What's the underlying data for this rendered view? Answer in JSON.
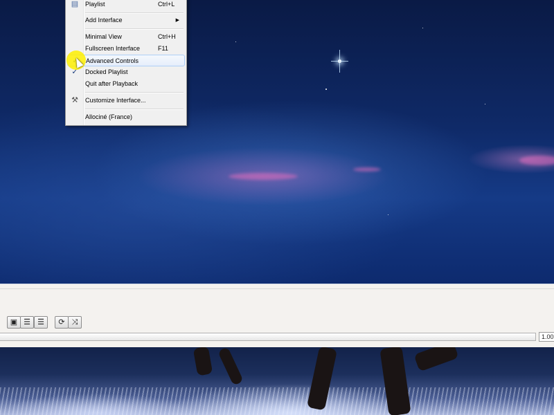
{
  "menu": {
    "items": [
      {
        "label": "Playlist",
        "shortcut": "Ctrl+L",
        "icon": "playlist-icon"
      },
      {
        "label": "Add Interface",
        "submenu": true
      },
      {
        "label": "Minimal View",
        "shortcut": "Ctrl+H"
      },
      {
        "label": "Fullscreen Interface",
        "shortcut": "F11"
      },
      {
        "label": "Advanced Controls",
        "checked": true,
        "highlighted": true
      },
      {
        "label": "Docked Playlist",
        "checked": true
      },
      {
        "label": "Quit after Playback"
      },
      {
        "label": "Customize Interface...",
        "icon": "tools-icon"
      },
      {
        "label": "Allociné (France)"
      }
    ]
  },
  "controls": {
    "buttons": [
      {
        "name": "frame-by-frame-button",
        "icon": "frame-icon"
      },
      {
        "name": "toggle-playlist-button",
        "icon": "playlist-icon"
      },
      {
        "name": "extended-settings-button",
        "icon": "equalizer-icon"
      },
      {
        "name": "loop-button",
        "icon": "loop-icon"
      },
      {
        "name": "shuffle-button",
        "icon": "shuffle-icon"
      }
    ],
    "playback_speed": "1.00",
    "progress": 0
  },
  "colors": {
    "menu_bg": "#f0f0f0",
    "highlight": "#aecff7",
    "cursor_highlight": "#fff000"
  }
}
